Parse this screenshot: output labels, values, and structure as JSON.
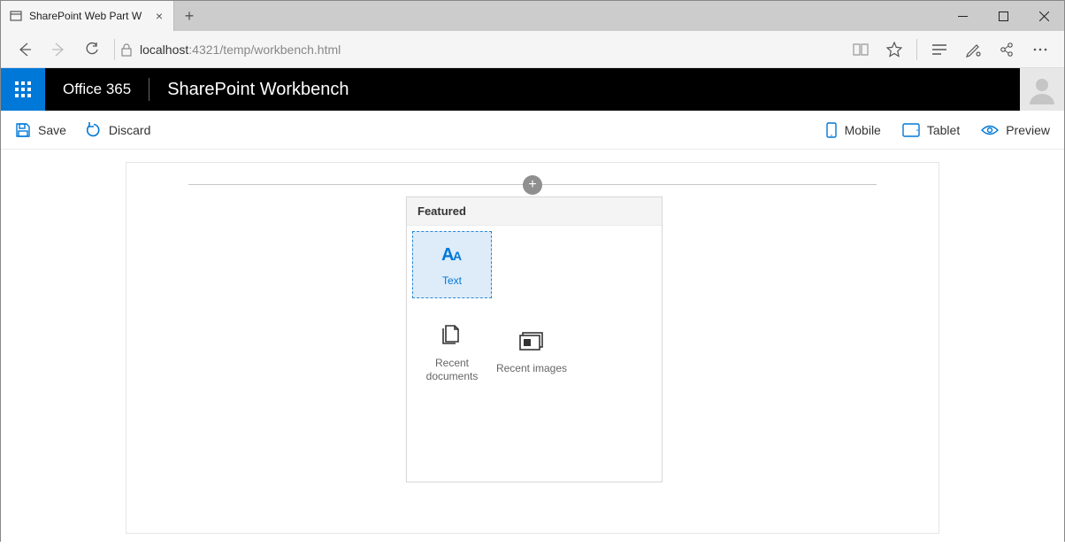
{
  "browser": {
    "tab_title": "SharePoint Web Part W",
    "url_host": "localhost",
    "url_port": ":4321",
    "url_path": "/temp/workbench.html"
  },
  "suite": {
    "brand": "Office 365",
    "app": "SharePoint Workbench"
  },
  "commands": {
    "save": "Save",
    "discard": "Discard",
    "mobile": "Mobile",
    "tablet": "Tablet",
    "preview": "Preview"
  },
  "picker": {
    "header": "Featured",
    "items": {
      "text": "Text",
      "recent_docs": "Recent documents",
      "recent_images": "Recent images"
    }
  }
}
